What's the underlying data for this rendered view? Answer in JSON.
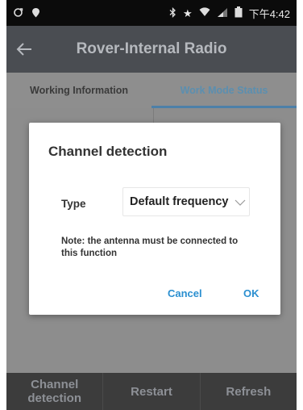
{
  "status_bar": {
    "time": "下午4:42",
    "icons": [
      "sync-icon",
      "location-pin-icon",
      "bluetooth-icon",
      "star-icon",
      "wifi-icon",
      "signal-icon",
      "battery-icon"
    ]
  },
  "app_bar": {
    "title": "Rover-Internal Radio"
  },
  "tabs": [
    {
      "label": "Working Information",
      "active": false
    },
    {
      "label": "Work Mode Status",
      "active": true
    }
  ],
  "dialog": {
    "title": "Channel detection",
    "type_label": "Type",
    "type_value": "Default frequency",
    "note": "Note: the antenna must be connected to this function",
    "cancel_label": "Cancel",
    "ok_label": "OK"
  },
  "bottom_bar": {
    "channel_detection": "Channel detection",
    "restart": "Restart",
    "refresh": "Refresh"
  },
  "colors": {
    "accent": "#2b8fd0",
    "tab_active": "#5b8fb0",
    "scrim": "#8f8f8f"
  }
}
